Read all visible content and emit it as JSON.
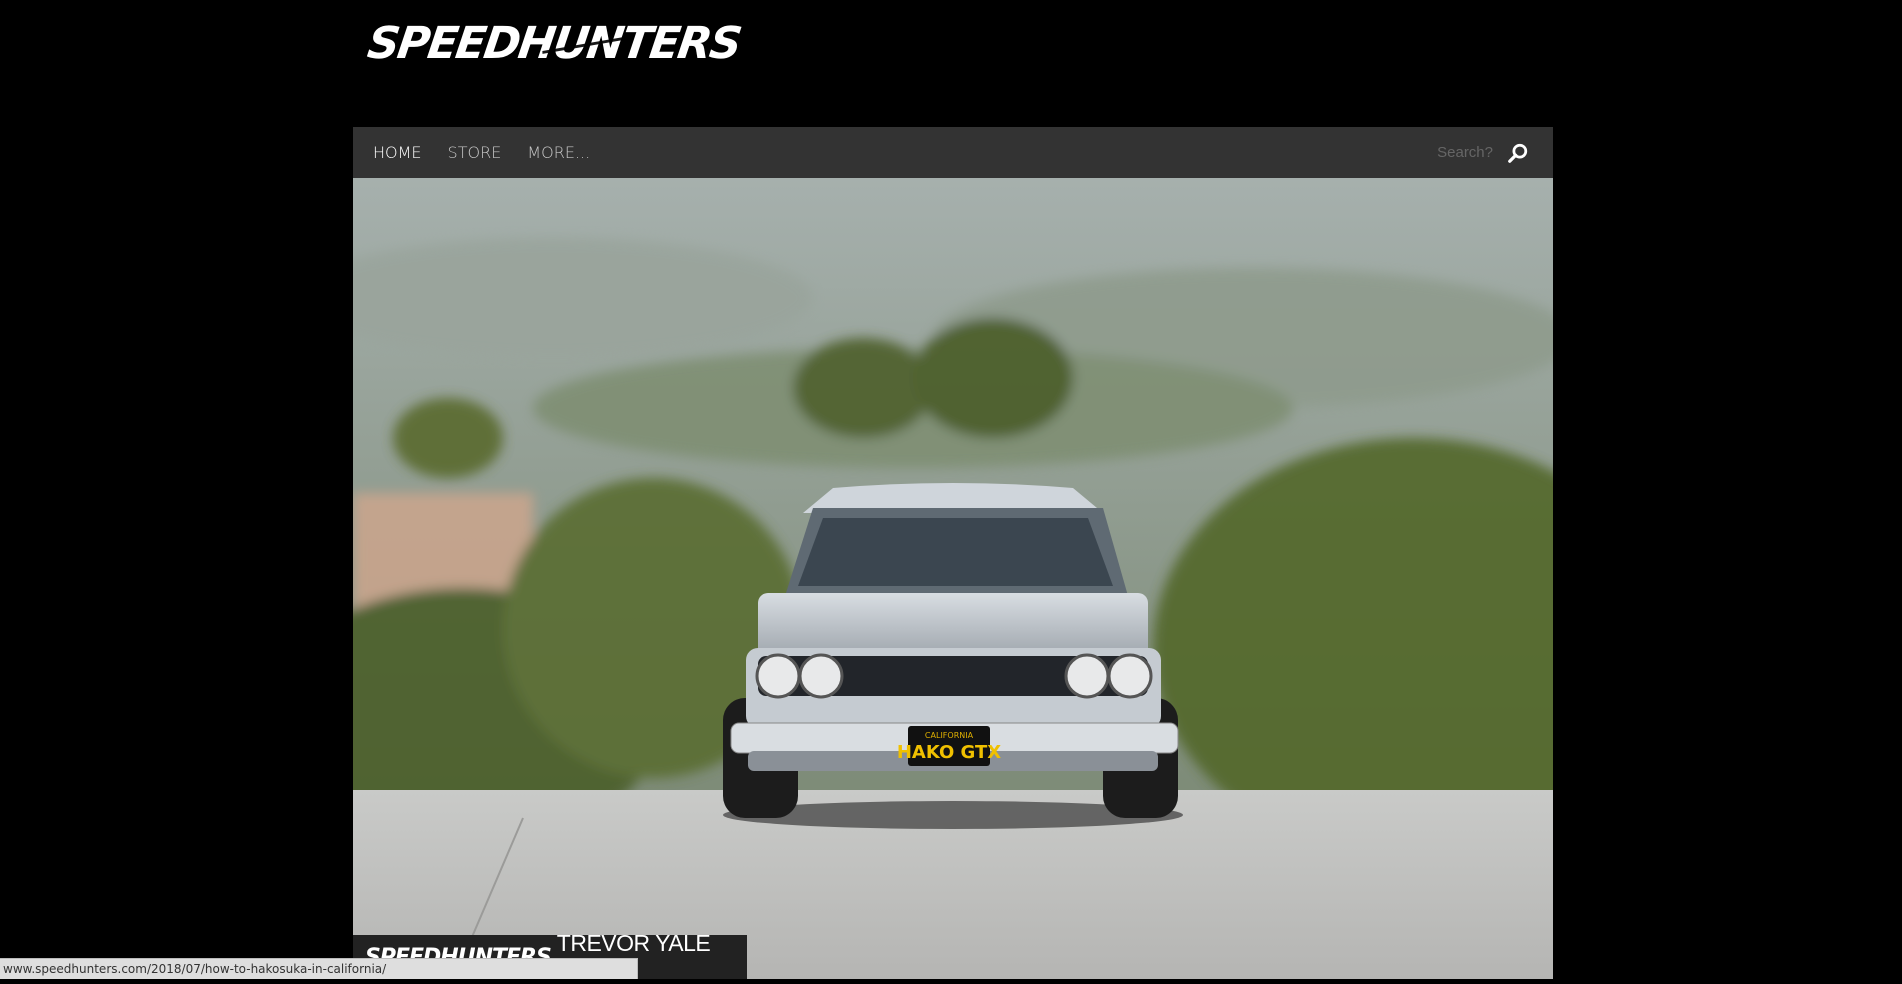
{
  "header": {
    "logo_text": "SPEEDHUNTERS"
  },
  "nav": {
    "items": [
      {
        "label": "HOME",
        "active": true
      },
      {
        "label": "STORE",
        "active": false
      },
      {
        "label": "MORE...",
        "active": false
      }
    ],
    "search_placeholder": "Search?"
  },
  "hero": {
    "plate_top": "CALIFORNIA",
    "plate_text": "HAKO GTX",
    "credit_logo": "SPEEDHUNTERS",
    "credit_author": "TREVOR YALE RYAN"
  },
  "status_bar": {
    "url": "www.speedhunters.com/2018/07/how-to-hakosuka-in-california/"
  }
}
